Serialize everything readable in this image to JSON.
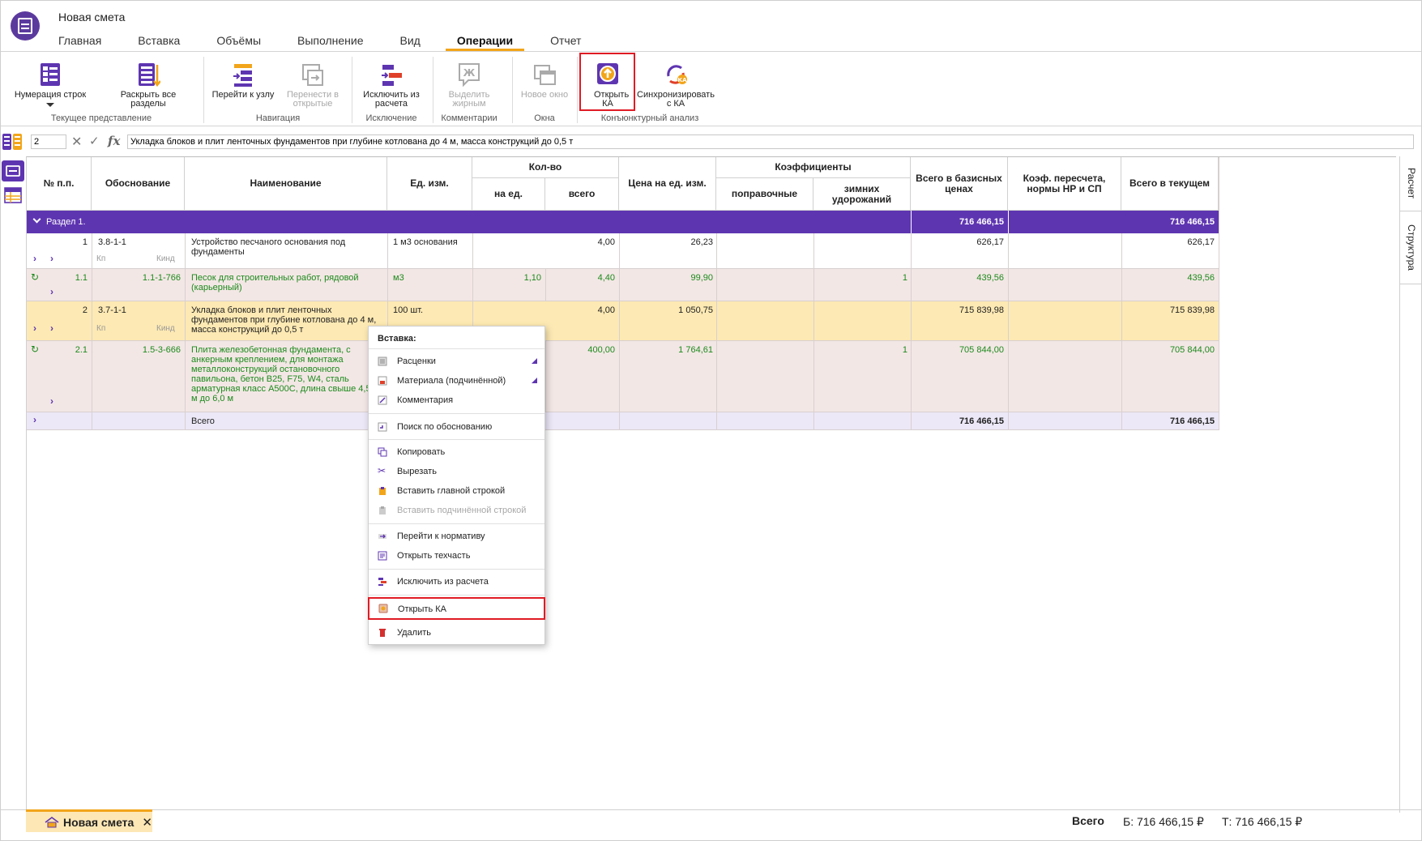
{
  "window": {
    "title": "Новая смета"
  },
  "menu": {
    "tabs": [
      "Главная",
      "Вставка",
      "Объёмы",
      "Выполнение",
      "Вид",
      "Операции",
      "Отчет"
    ],
    "active": "Операции"
  },
  "ribbon": {
    "numbering": "Нумерация строк",
    "expand_all": "Раскрыть все разделы",
    "group_current_view": "Текущее представление",
    "go_to_node": "Перейти к узлу",
    "move_to_opened": "Перенести в открытые",
    "group_navigation": "Навигация",
    "exclude_from_calc": "Исключить из расчета",
    "group_exclusion": "Исключение",
    "make_bold": "Выделить жирным",
    "group_comments": "Комментарии",
    "new_window": "Новое окно",
    "group_windows": "Окна",
    "open_ka": "Открыть КА",
    "sync_ka": "Синхронизировать с КА",
    "group_market": "Конъюнктурный анализ"
  },
  "formula_bar": {
    "cell_ref": "2",
    "value": "Укладка блоков и плит ленточных фундаментов при глубине котлована до 4 м, масса конструкций до 0,5 т"
  },
  "side_tabs": [
    "Расчет",
    "Структура"
  ],
  "grid": {
    "headers": {
      "num": "№ п.п.",
      "basis": "Обоснование",
      "name": "Наименование",
      "unit": "Ед. изм.",
      "qty": "Кол-во",
      "qty_per": "на ед.",
      "qty_total": "всего",
      "price": "Цена на ед. изм.",
      "coef": "Коэффициенты",
      "coef_corr": "поправочные",
      "coef_winter": "зимних удорожаний",
      "total_base": "Всего в базисных ценах",
      "recalc": "Коэф. пересчета, нормы НР и СП",
      "total_current": "Всего в текущем"
    },
    "section": {
      "label": "Раздел 1.",
      "total_base": "716 466,15",
      "total_current": "716 466,15"
    },
    "rows": [
      {
        "num": "1",
        "basis": "3.8-1-1",
        "kp": "Кп",
        "kind": "Кинд",
        "name": "Устройство песчаного основания под фундаменты",
        "unit": "1 м3 основания",
        "qty_per": "",
        "qty_total": "4,00",
        "price": "26,23",
        "coef_winter": "",
        "total_base": "626,17",
        "total_current": "626,17"
      },
      {
        "num": "1.1",
        "basis": "1.1-1-766",
        "name": "Песок для строительных работ, рядовой (карьерный)",
        "unit": "м3",
        "qty_per": "1,10",
        "qty_total": "4,40",
        "price": "99,90",
        "coef_winter": "1",
        "total_base": "439,56",
        "total_current": "439,56"
      },
      {
        "num": "2",
        "basis": "3.7-1-1",
        "kp": "Кп",
        "kind": "Кинд",
        "name": "Укладка блоков и плит ленточных фундаментов при глубине котлована до 4 м, масса конструкций до 0,5 т",
        "unit": "100 шт.",
        "qty_per": "",
        "qty_total": "4,00",
        "price": "1 050,75",
        "coef_winter": "",
        "total_base": "715 839,98",
        "total_current": "715 839,98"
      },
      {
        "num": "2.1",
        "basis": "1.5-3-666",
        "name": "Плита железобетонная фундамента, с анкерным креплением, для монтажа металлоконструкций остановочного павильона, бетон B25, F75, W4, сталь арматурная класс А500С, длина свыше 4,5 м до 6,0 м",
        "unit": "",
        "qty_per": "",
        "qty_total": "400,00",
        "price": "1 764,61",
        "coef_winter": "1",
        "total_base": "705 844,00",
        "total_current": "705 844,00"
      }
    ],
    "total_row": {
      "label": "Всего",
      "total_base": "716 466,15",
      "total_current": "716 466,15"
    }
  },
  "context_menu": {
    "header": "Вставка:",
    "items": [
      "Расценки",
      "Материала (подчинённой)",
      "Комментария",
      "Поиск по обоснованию",
      "Копировать",
      "Вырезать",
      "Вставить главной строкой",
      "Вставить подчинённой строкой",
      "Перейти к нормативу",
      "Открыть техчасть",
      "Исключить из расчета",
      "Открыть КА",
      "Удалить"
    ]
  },
  "bottom": {
    "doc_tab": "Новая смета",
    "total_label": "Всего",
    "base": "Б: 716 466,15 ₽",
    "current": "Т: 716 466,15 ₽"
  },
  "colors": {
    "accent": "#5e35b1",
    "tab_underline": "#f2a51a",
    "highlight": "#e01b24",
    "green_text": "#1c8a1c"
  }
}
